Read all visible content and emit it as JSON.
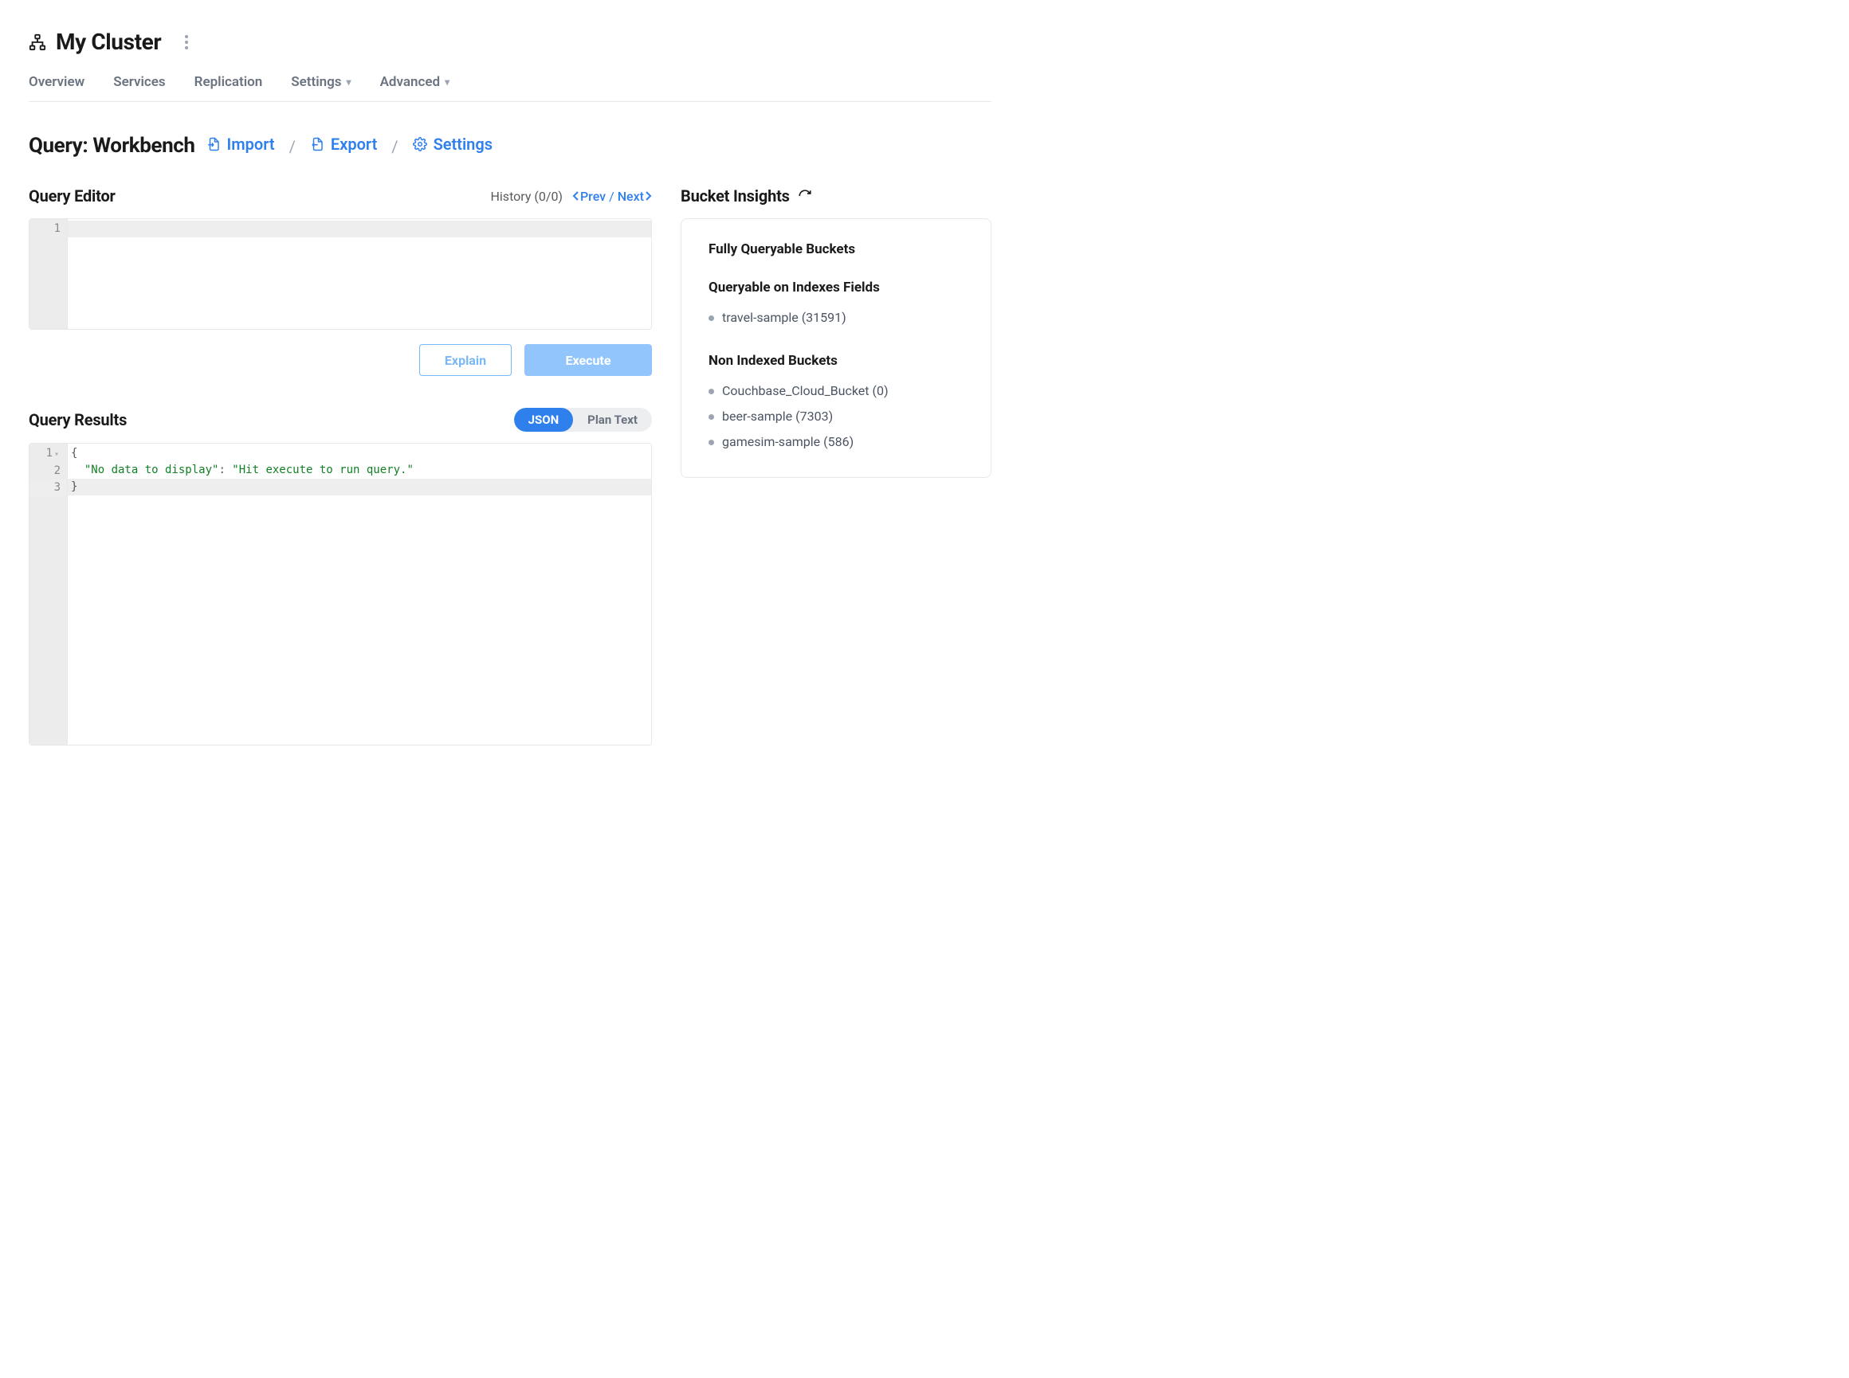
{
  "header": {
    "cluster_name": "My Cluster"
  },
  "nav": {
    "tabs": [
      {
        "label": "Overview",
        "has_caret": false
      },
      {
        "label": "Services",
        "has_caret": false
      },
      {
        "label": "Replication",
        "has_caret": false
      },
      {
        "label": "Settings",
        "has_caret": true
      },
      {
        "label": "Advanced",
        "has_caret": true
      }
    ]
  },
  "page": {
    "title": "Query: Workbench",
    "actions": {
      "import": "Import",
      "export": "Export",
      "settings": "Settings"
    }
  },
  "editor": {
    "title": "Query Editor",
    "history_label": "History (0/0)",
    "prev": "Prev",
    "next": "Next",
    "line1": "1",
    "explain": "Explain",
    "execute": "Execute"
  },
  "results": {
    "title": "Query Results",
    "seg_json": "JSON",
    "seg_plan": "Plan Text",
    "lines": {
      "l1n": "1",
      "l2n": "2",
      "l3n": "3",
      "l1": "{",
      "l2_key": "\"No data to display\"",
      "l2_sep": ": ",
      "l2_val": "\"Hit execute to run query.\"",
      "l3": "}"
    }
  },
  "insights": {
    "title": "Bucket Insights",
    "fully_title": "Fully Queryable Buckets",
    "indexed_title": "Queryable on Indexes Fields",
    "non_indexed_title": "Non Indexed Buckets",
    "indexed": [
      "travel-sample (31591)"
    ],
    "non_indexed": [
      "Couchbase_Cloud_Bucket (0)",
      "beer-sample (7303)",
      "gamesim-sample (586)"
    ]
  }
}
